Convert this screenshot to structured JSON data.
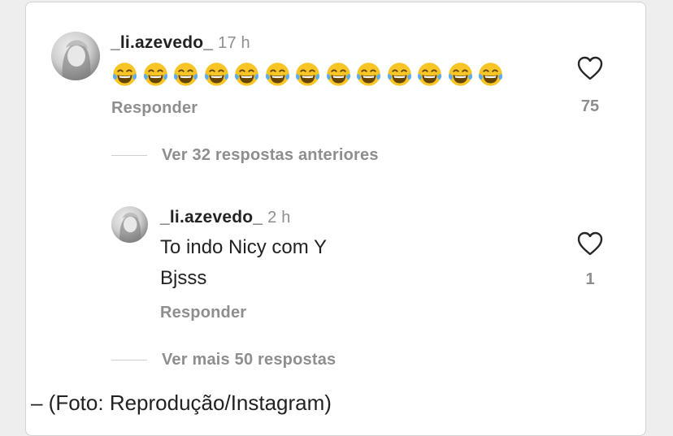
{
  "comment": {
    "username": "_li.azevedo_",
    "time": "17 h",
    "emoji_count": 13,
    "emoji_name": "face-with-tears-of-joy-icon",
    "reply_label": "Responder",
    "likes": "75"
  },
  "view_previous": "Ver 32 respostas anteriores",
  "reply": {
    "username": "_li.azevedo_",
    "time": "2 h",
    "line1": "To indo Nicy com Y",
    "line2": "Bjsss",
    "reply_label": "Responder",
    "likes": "1"
  },
  "view_more": "Ver mais 50 respostas",
  "caption": "– (Foto: Reprodução/Instagram)",
  "colors": {
    "background": "#eeeeee",
    "card": "#ffffff",
    "muted_text": "#8e8e8e",
    "text": "#222222",
    "emoji_face": "#f7c526"
  }
}
